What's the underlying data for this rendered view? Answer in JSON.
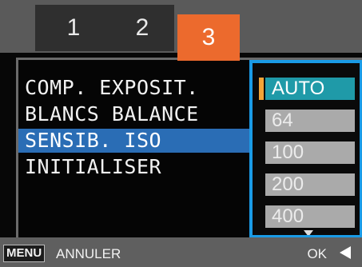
{
  "tabs": [
    {
      "label": "1"
    },
    {
      "label": "2"
    },
    {
      "label": "3",
      "active": true
    }
  ],
  "menu": {
    "items": [
      {
        "label": "COMP. EXPOSIT."
      },
      {
        "label": "BLANCS BALANCE"
      },
      {
        "label": "SENSIB. ISO",
        "selected": true
      },
      {
        "label": "INITIALISER"
      }
    ]
  },
  "options": {
    "items": [
      {
        "label": "AUTO",
        "current": true
      },
      {
        "label": "64"
      },
      {
        "label": "100"
      },
      {
        "label": "200"
      },
      {
        "label": "400"
      }
    ]
  },
  "footer": {
    "menu_button": "MENU",
    "cancel_label": "ANNULER",
    "ok_label": "OK"
  },
  "colors": {
    "active_tab": "#ec6a2d",
    "selection": "#2a6db5",
    "options_border": "#1a9be6",
    "current_option": "#1f9aa8"
  },
  "icons": [
    "left-arrow-icon",
    "down-arrow-icon",
    "ok-arrow-icon"
  ]
}
